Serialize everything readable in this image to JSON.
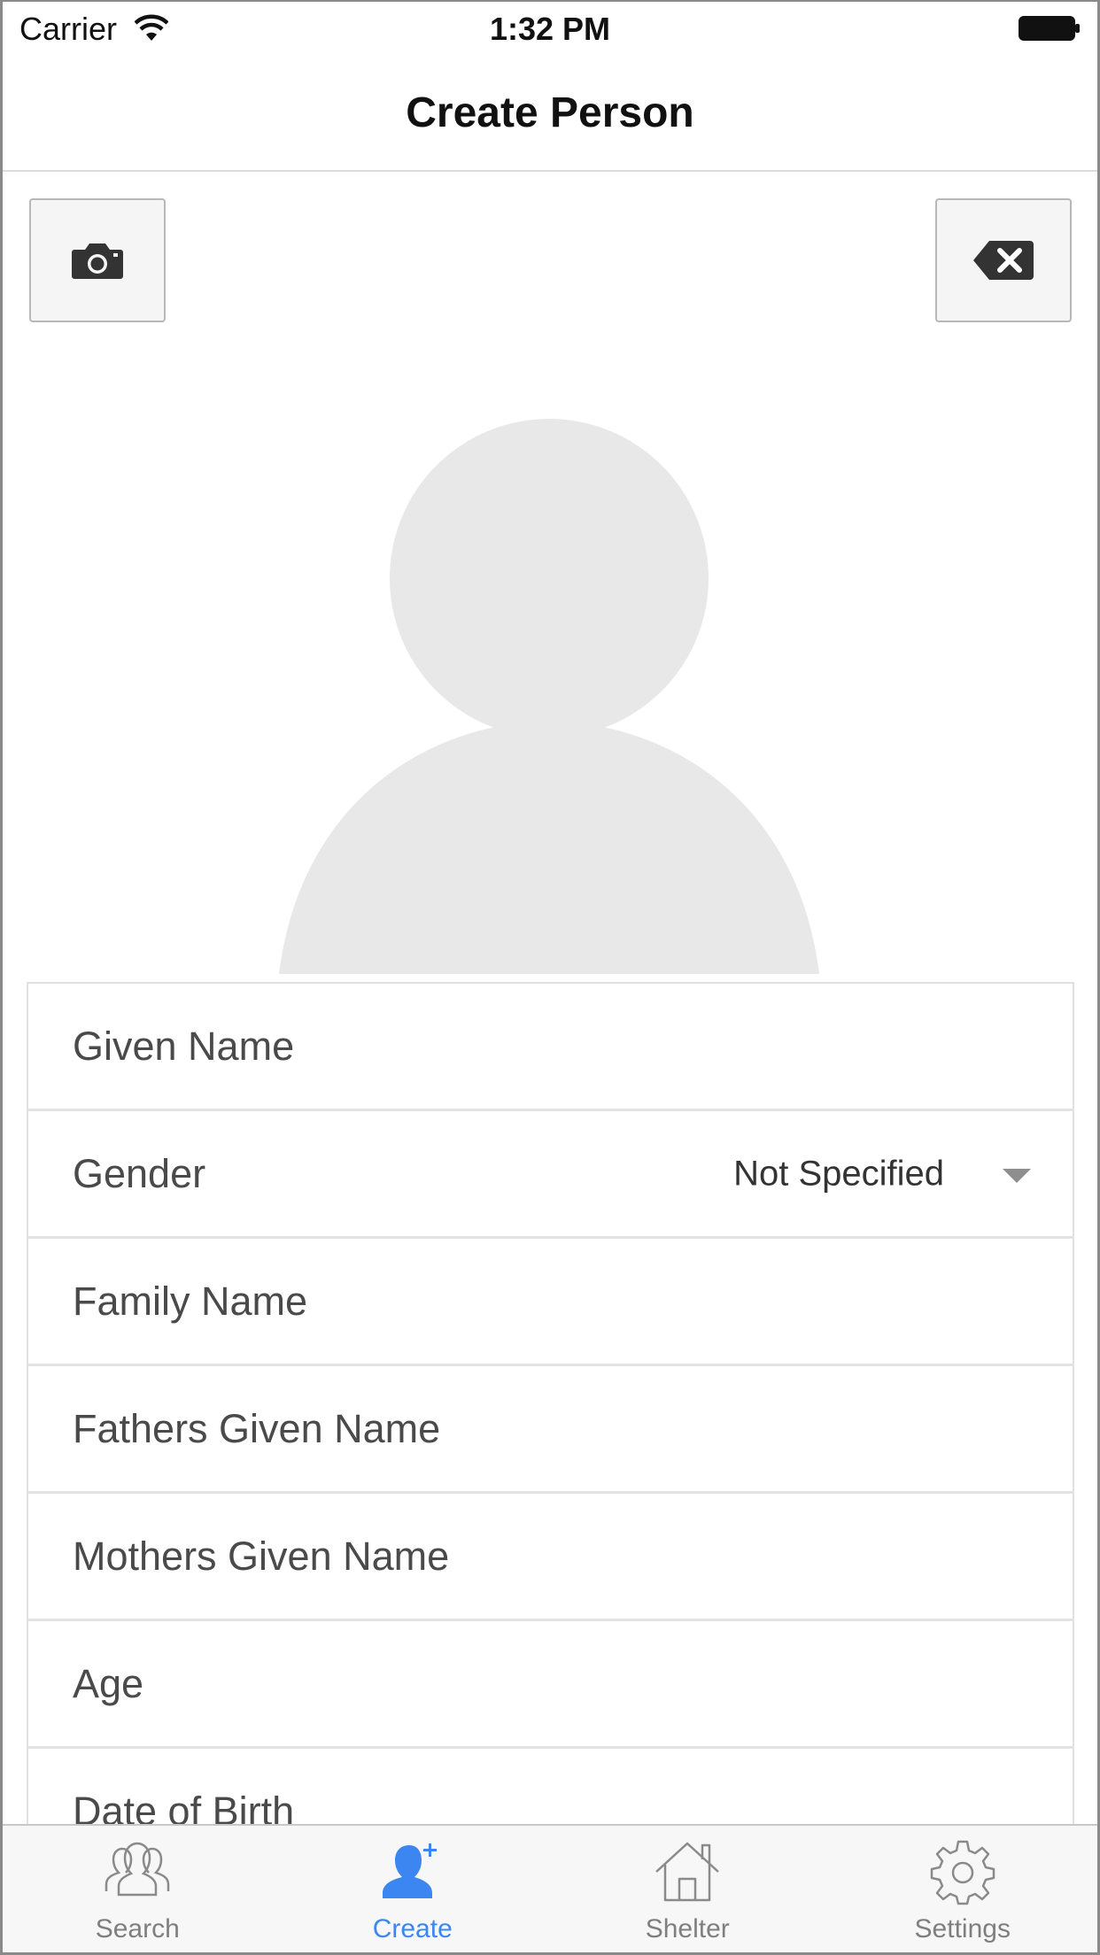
{
  "status_bar": {
    "carrier": "Carrier",
    "time": "1:32 PM"
  },
  "nav": {
    "title": "Create Person"
  },
  "photo_actions": {
    "camera_icon": "camera-icon",
    "clear_icon": "backspace-clear-icon"
  },
  "form": {
    "rows": [
      {
        "label": "Given Name"
      },
      {
        "label": "Gender",
        "value": "Not Specified"
      },
      {
        "label": "Family Name"
      },
      {
        "label": "Fathers Given Name"
      },
      {
        "label": "Mothers Given Name"
      },
      {
        "label": "Age"
      },
      {
        "label": "Date of Birth"
      }
    ]
  },
  "tabs": [
    {
      "label": "Search",
      "icon": "people-icon",
      "active": false
    },
    {
      "label": "Create",
      "icon": "person-add-icon",
      "active": true
    },
    {
      "label": "Shelter",
      "icon": "house-icon",
      "active": false
    },
    {
      "label": "Settings",
      "icon": "gear-icon",
      "active": false
    }
  ],
  "colors": {
    "accent": "#3b86f0",
    "inactive_tab": "#7f7f7f",
    "avatar_placeholder": "#e8e8e8"
  }
}
